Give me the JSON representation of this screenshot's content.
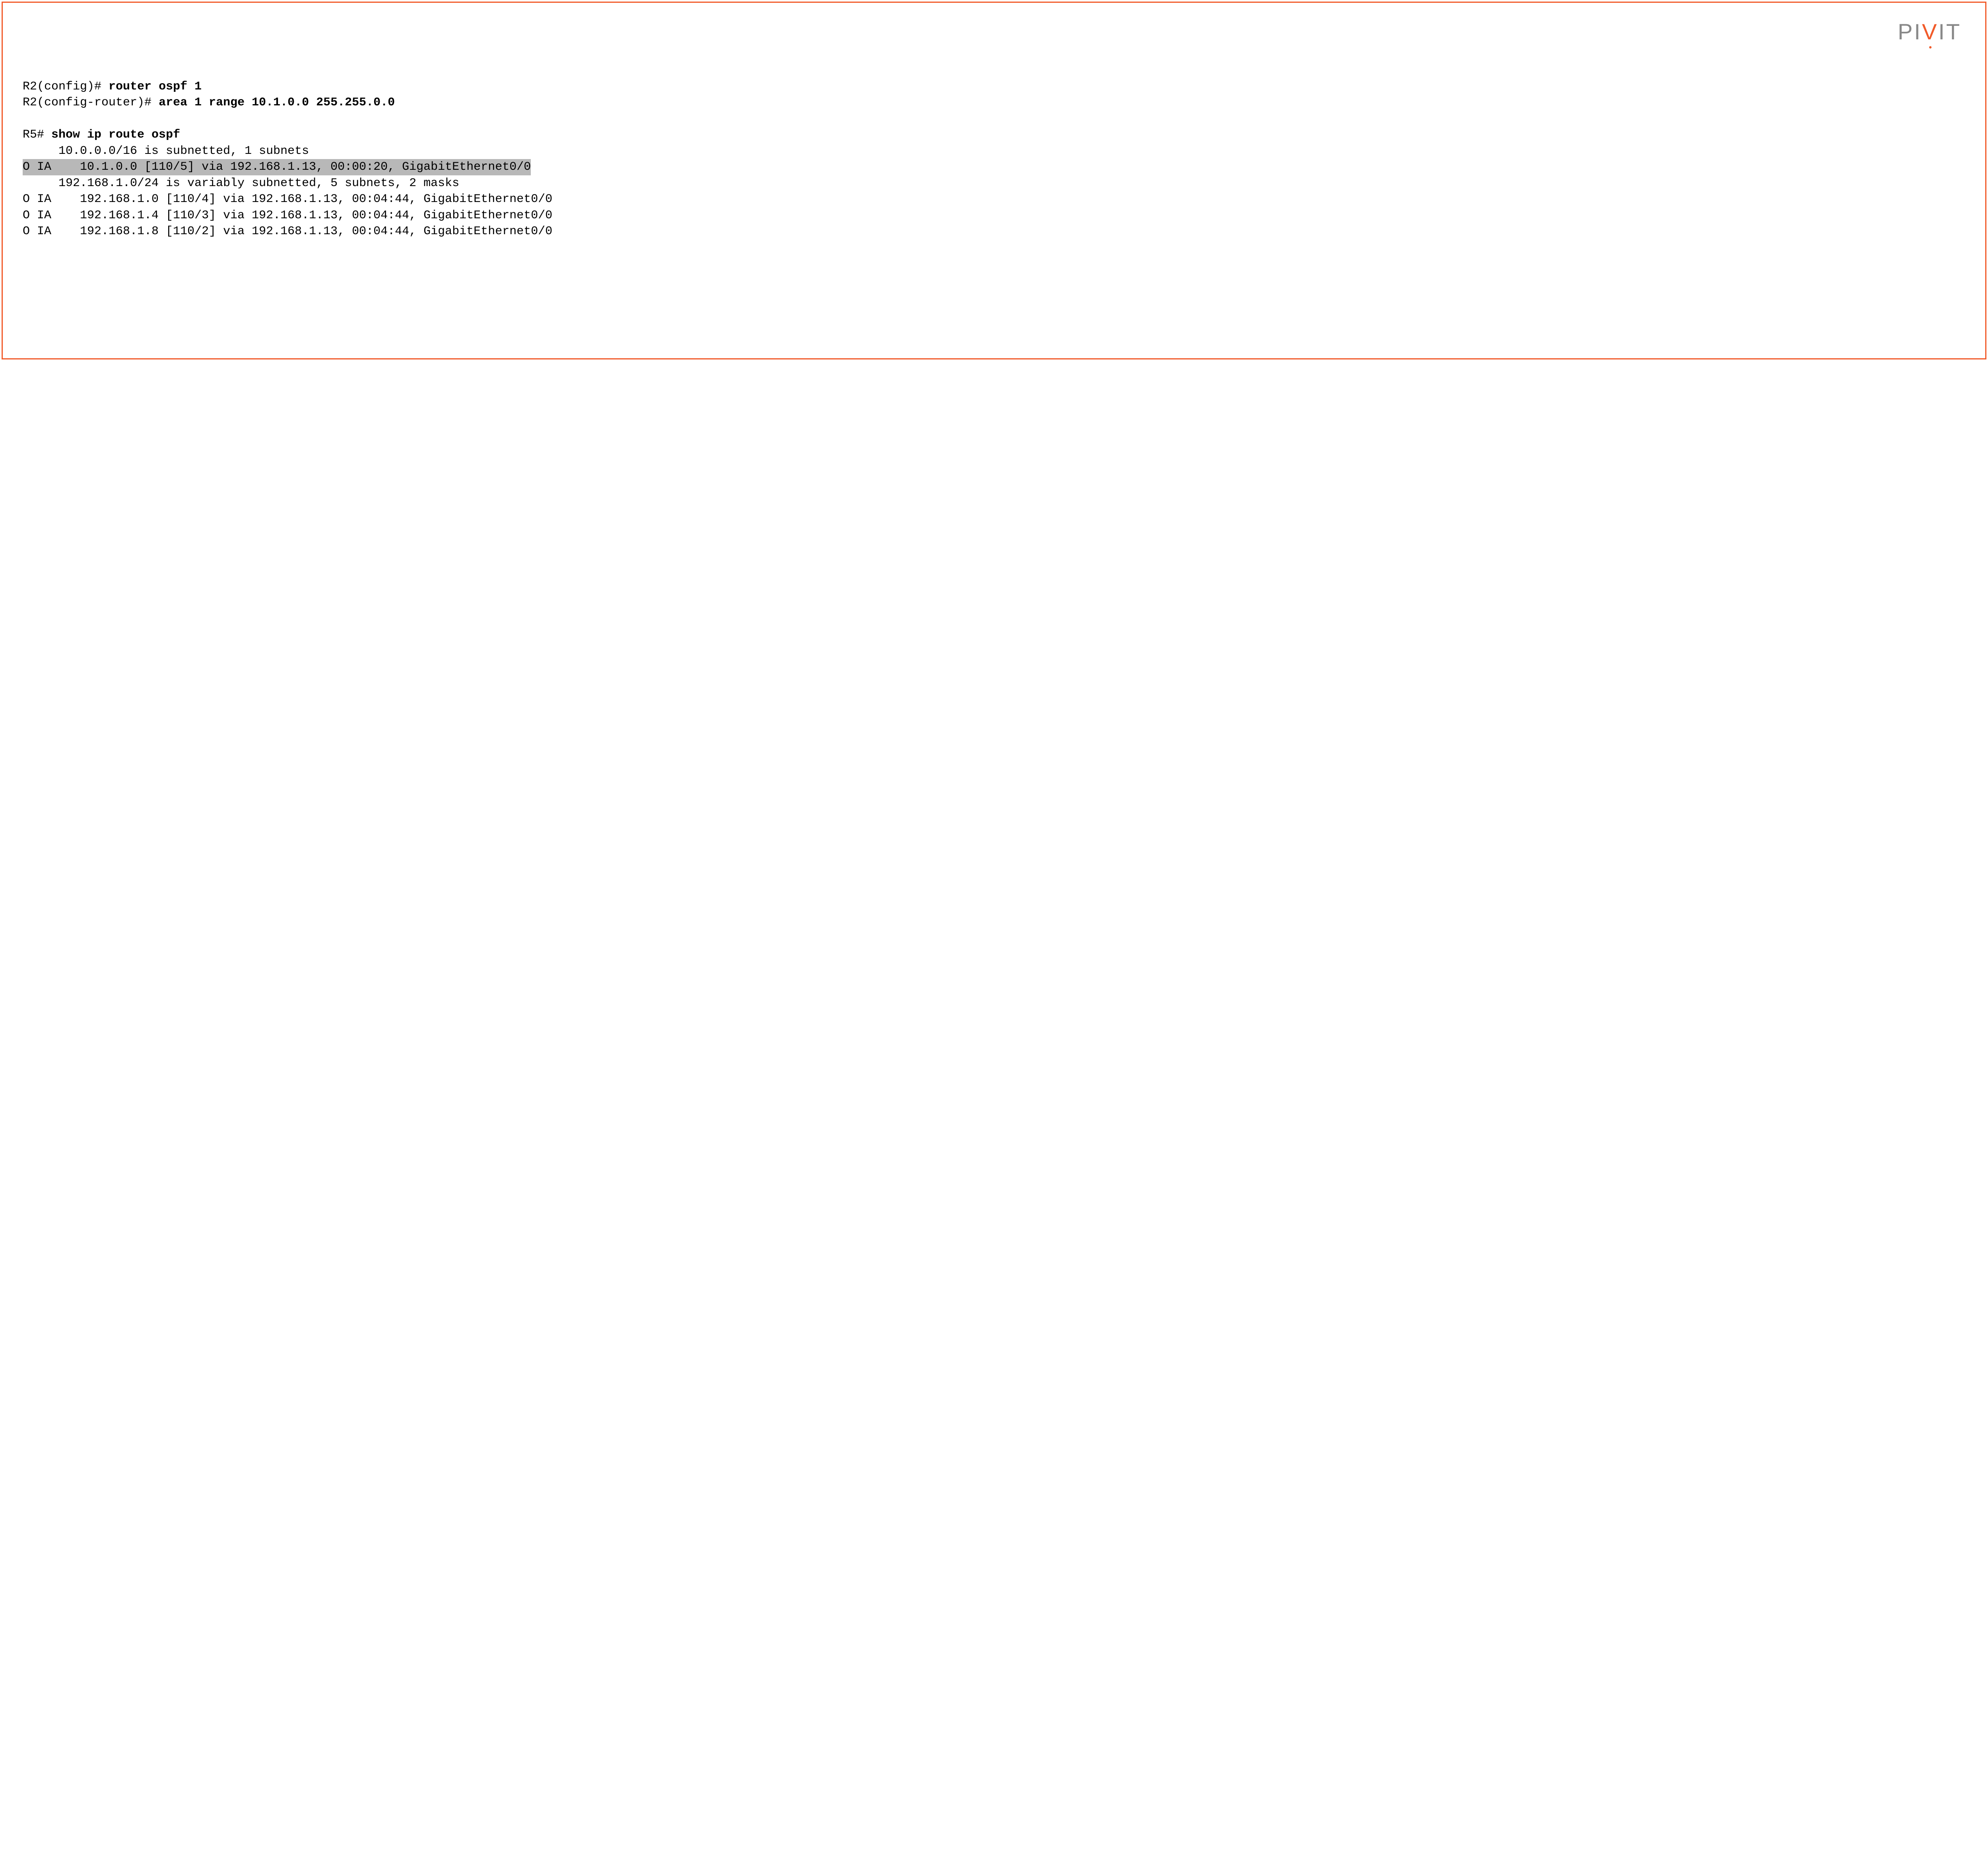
{
  "logo": {
    "p1": "PI",
    "accent": "V",
    "p2": "IT"
  },
  "lines": {
    "l1_prompt": "R2(config)# ",
    "l1_cmd": "router ospf 1",
    "l2_prompt": "R2(config-router)# ",
    "l2_cmd": "area 1 range 10.1.0.0 255.255.0.0",
    "l3_prompt": "R5# ",
    "l3_cmd": "show ip route ospf",
    "l4": "     10.0.0.0/16 is subnetted, 1 subnets",
    "l5": "O IA    10.1.0.0 [110/5] via 192.168.1.13, 00:00:20, GigabitEthernet0/0",
    "l6": "     192.168.1.0/24 is variably subnetted, 5 subnets, 2 masks",
    "l7": "O IA    192.168.1.0 [110/4] via 192.168.1.13, 00:04:44, GigabitEthernet0/0",
    "l8": "O IA    192.168.1.4 [110/3] via 192.168.1.13, 00:04:44, GigabitEthernet0/0",
    "l9": "O IA    192.168.1.8 [110/2] via 192.168.1.13, 00:04:44, GigabitEthernet0/0"
  }
}
